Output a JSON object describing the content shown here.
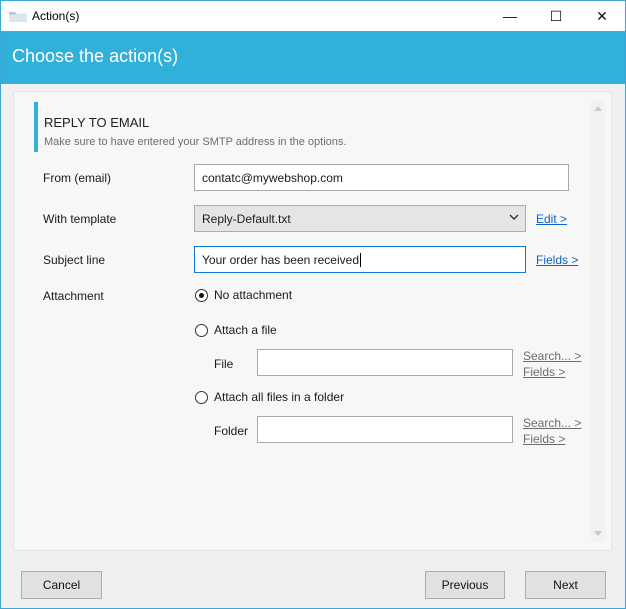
{
  "window": {
    "title": "Action(s)",
    "controls": {
      "minimize": "—",
      "maximize": "☐",
      "close": "✕"
    }
  },
  "header": {
    "title": "Choose the action(s)"
  },
  "section": {
    "title": "REPLY TO EMAIL",
    "subtitle": "Make sure to have entered your SMTP address in the options."
  },
  "form": {
    "from": {
      "label": "From (email)",
      "value": "contatc@mywebshop.com"
    },
    "template": {
      "label": "With template",
      "value": "Reply-Default.txt",
      "link": "Edit >"
    },
    "subject": {
      "label": "Subject line",
      "value": "Your order has been received",
      "link": "Fields >"
    },
    "attachment": {
      "label": "Attachment",
      "options": [
        {
          "label": "No attachment",
          "checked": true
        },
        {
          "label": "Attach a file",
          "checked": false
        },
        {
          "label": "Attach all files in a folder",
          "checked": false
        }
      ],
      "file": {
        "label": "File",
        "value": "",
        "search_link": "Search... >",
        "fields_link": "Fields >"
      },
      "folder": {
        "label": "Folder",
        "value": "",
        "search_link": "Search... >",
        "fields_link": "Fields >"
      }
    }
  },
  "footer": {
    "cancel": "Cancel",
    "previous": "Previous",
    "next": "Next"
  },
  "colors": {
    "accent": "#31b0da",
    "link": "#0c63c9",
    "disabled_link": "#6d6d6d"
  }
}
